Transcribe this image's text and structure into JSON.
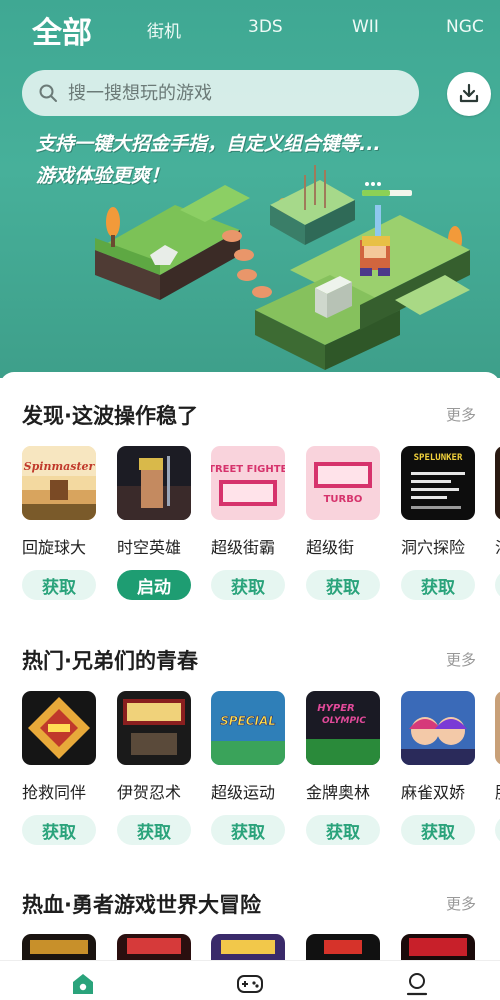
{
  "header": {
    "tabs": [
      "全部",
      "街机",
      "3DS",
      "WII",
      "NGC"
    ]
  },
  "search": {
    "placeholder": "搜一搜想玩的游戏"
  },
  "banner": {
    "line1": "支持一键大招金手指，自定义组合键等...",
    "line2": "游戏体验更爽！"
  },
  "sections": [
    {
      "title": "发现·这波操作稳了",
      "more": "更多",
      "games": [
        {
          "name": "回旋球大",
          "action": "获取"
        },
        {
          "name": "时空英雄",
          "action": "启动"
        },
        {
          "name": "超级街霸",
          "action": "获取"
        },
        {
          "name": "超级街",
          "action": "获取"
        },
        {
          "name": "洞穴探险",
          "action": "获取"
        },
        {
          "name": "沙",
          "action": "获取"
        }
      ]
    },
    {
      "title": "热门·兄弟们的青春",
      "more": "更多",
      "games": [
        {
          "name": "抢救同伴",
          "action": "获取"
        },
        {
          "name": "伊贺忍术",
          "action": "获取"
        },
        {
          "name": "超级运动",
          "action": "获取"
        },
        {
          "name": "金牌奥林",
          "action": "获取"
        },
        {
          "name": "麻雀双娇",
          "action": "获取"
        },
        {
          "name": "肌",
          "action": "获取"
        }
      ]
    },
    {
      "title": "热血·勇者游戏世界大冒险",
      "more": "更多"
    }
  ],
  "covers": {
    "spinmaster": "Spinmaster",
    "sf2": "STREET FIGHTER",
    "sf2_sub": "TURBO",
    "spelunker": "SPELUNKER",
    "hyper": "HYPER",
    "olympic": "OLYMPIC",
    "special": "SPECIAL"
  },
  "colors": {
    "accent": "#1e9d72",
    "accent_light": "#e6f6f1",
    "hero": "#45ad97"
  },
  "nav": [
    "home-icon",
    "gamepad-icon",
    "profile-icon"
  ]
}
